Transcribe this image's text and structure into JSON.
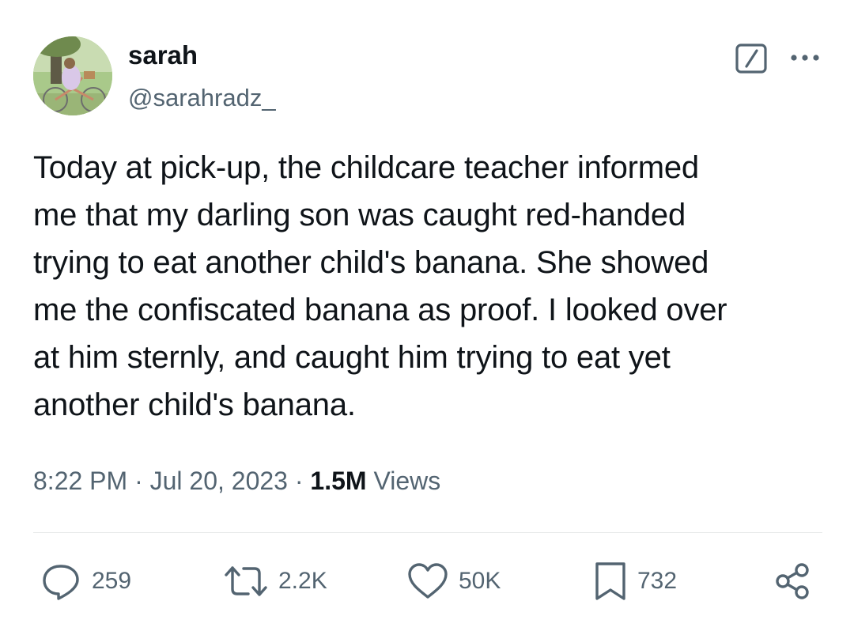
{
  "author": {
    "name": "sarah",
    "handle": "@sarahradz_"
  },
  "tweet": {
    "text": "Today at pick-up, the childcare teacher informed\nme that my darling son was caught red-handed\ntrying to eat another child's banana. She showed\nme the confiscated banana as proof. I looked over\nat him sternly, and caught him trying to eat yet\nanother child's banana."
  },
  "meta": {
    "time": "8:22 PM",
    "separator": " · ",
    "date": "Jul 20, 2023",
    "views_count": "1.5M",
    "views_label": "Views"
  },
  "actions": {
    "replies": "259",
    "reposts": "2.2K",
    "likes": "50K",
    "bookmarks": "732"
  },
  "icons": {
    "header": [
      "grok-icon",
      "more-icon"
    ],
    "actions": [
      "reply-icon",
      "repost-icon",
      "like-icon",
      "bookmark-icon",
      "share-icon"
    ]
  },
  "colors": {
    "text_primary": "#0f1419",
    "text_secondary": "#536471",
    "divider": "#e7e9ea"
  }
}
